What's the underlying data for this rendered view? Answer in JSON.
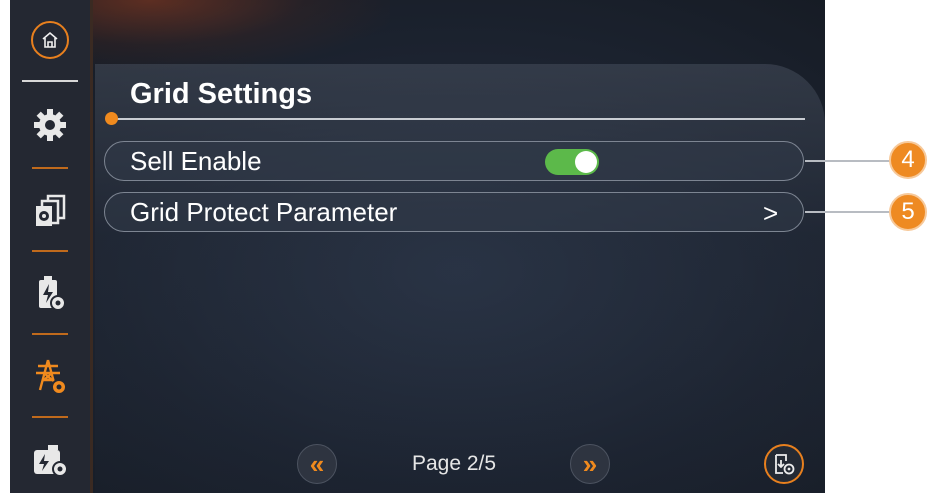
{
  "sidebar": {
    "items": [
      {
        "icon": "home-icon"
      },
      {
        "icon": "gear-icon"
      },
      {
        "icon": "multi-settings-icon"
      },
      {
        "icon": "battery-settings-icon"
      },
      {
        "icon": "grid-tower-settings-icon",
        "active": true
      },
      {
        "icon": "generator-settings-icon"
      }
    ]
  },
  "main": {
    "title": "Grid Settings",
    "rows": [
      {
        "label": "Sell Enable",
        "toggle_on": true
      },
      {
        "label": "Grid Protect Parameter",
        "chevron": ">"
      }
    ]
  },
  "callouts": [
    "4",
    "5"
  ],
  "pager": {
    "prev": "«",
    "next": "»",
    "page_text": "Page 2/5"
  },
  "colors": {
    "accent": "#f08a1e",
    "toggle_on": "#5cb94a",
    "callout": "#ee8a22"
  }
}
